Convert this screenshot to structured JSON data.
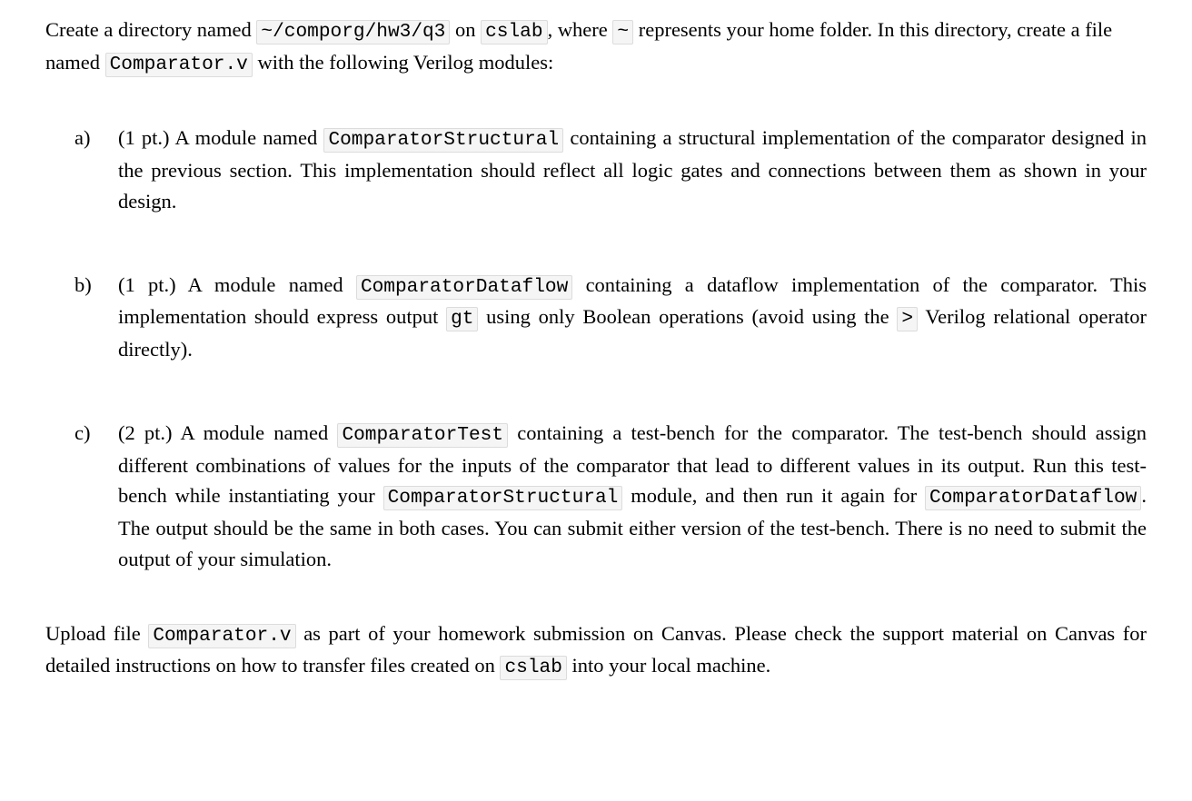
{
  "intro": {
    "t1": "Create a directory named ",
    "c1": "~/comporg/hw3/q3",
    "t2": " on ",
    "c2": "cslab",
    "t3": ", where ",
    "c3": "~",
    "t4": " represents your home folder. In this directory, create a file named ",
    "c4": "Comparator.v",
    "t5": " with the following Verilog modules:"
  },
  "a": {
    "marker": "a)",
    "t1": "(1 pt.) A module named ",
    "c1": "ComparatorStructural",
    "t2": " containing a structural implementation of the comparator designed in the previous section. This implementation should reflect all logic gates and connections between them as shown in your design."
  },
  "b": {
    "marker": "b)",
    "t1": "(1 pt.) A module named ",
    "c1": "ComparatorDataflow",
    "t2": " containing a dataflow implementation of the comparator. This implementation should express output ",
    "c2": "gt",
    "t3": " using only Boolean operations (avoid using the ",
    "c3": ">",
    "t4": " Verilog relational operator directly)."
  },
  "c": {
    "marker": "c)",
    "t1": "(2 pt.) A module named ",
    "c1": "ComparatorTest",
    "t2": " containing a test-bench for the comparator. The test-bench should assign different combinations of values for the inputs of the comparator that lead to different values in its output. Run this test-bench while instantiating your ",
    "c2": "ComparatorStructural",
    "t3": " module, and then run it again for ",
    "c3": "ComparatorDataflow",
    "t4": ". The output should be the same in both cases. You can submit either version of the test-bench. There is no need to submit the output of your simulation."
  },
  "closing": {
    "t1": "Upload file ",
    "c1": "Comparator.v",
    "t2": " as part of your homework submission on Canvas. Please check the support material on Canvas for detailed instructions on how to transfer files created on ",
    "c2": "cslab",
    "t3": " into your local machine."
  }
}
